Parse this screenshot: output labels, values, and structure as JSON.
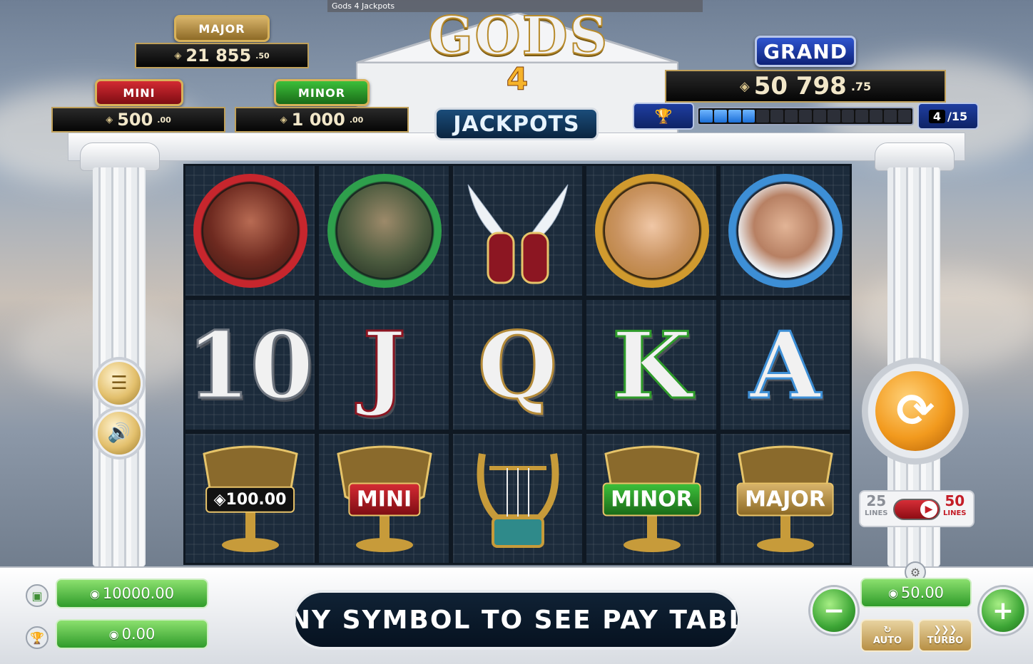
{
  "window": {
    "title": "Gods 4 Jackpots"
  },
  "logo": {
    "title": "GODS",
    "number": "4",
    "subtitle": "JACKPOTS"
  },
  "jackpots": {
    "major": {
      "label": "MAJOR",
      "value": "21 855",
      "cents": ".50"
    },
    "mini": {
      "label": "MINI",
      "value": "500",
      "cents": ".00"
    },
    "minor": {
      "label": "MINOR",
      "value": "1 000",
      "cents": ".00"
    },
    "grand": {
      "label": "GRAND",
      "value": "50 798",
      "cents": ".75"
    }
  },
  "progress": {
    "current": "4",
    "total": "/15",
    "filled_fraction": 0.267
  },
  "reels": {
    "row1": [
      "ares-icon",
      "hades-icon",
      "hermes-sandals-icon",
      "aphrodite-icon",
      "zeus-icon"
    ],
    "row2": [
      "10",
      "J",
      "Q",
      "K",
      "A"
    ],
    "row3": {
      "cup1": "100.00",
      "cup2": "MINI",
      "cup3": "lyre-icon",
      "cup4": "MINOR",
      "cup5": "MAJOR"
    }
  },
  "lines": {
    "low": "25",
    "low_caption": "LINES",
    "high": "50",
    "high_caption": "LINES"
  },
  "balance": {
    "credit": "10000.00",
    "win": "0.00"
  },
  "bet": {
    "value": "50.00"
  },
  "banner": {
    "text": "ANY SYMBOL TO SEE PAY TABLE"
  },
  "buttons": {
    "auto": "AUTO",
    "turbo": "TURBO",
    "turbo_glyph": "❯❯❯",
    "minus": "−",
    "plus": "+"
  },
  "colors": {
    "mini": "#b3171f",
    "minor": "#2f9c2b",
    "major": "#b48b3a",
    "grand": "#1a3aa4",
    "spin": "#f29a1e"
  }
}
